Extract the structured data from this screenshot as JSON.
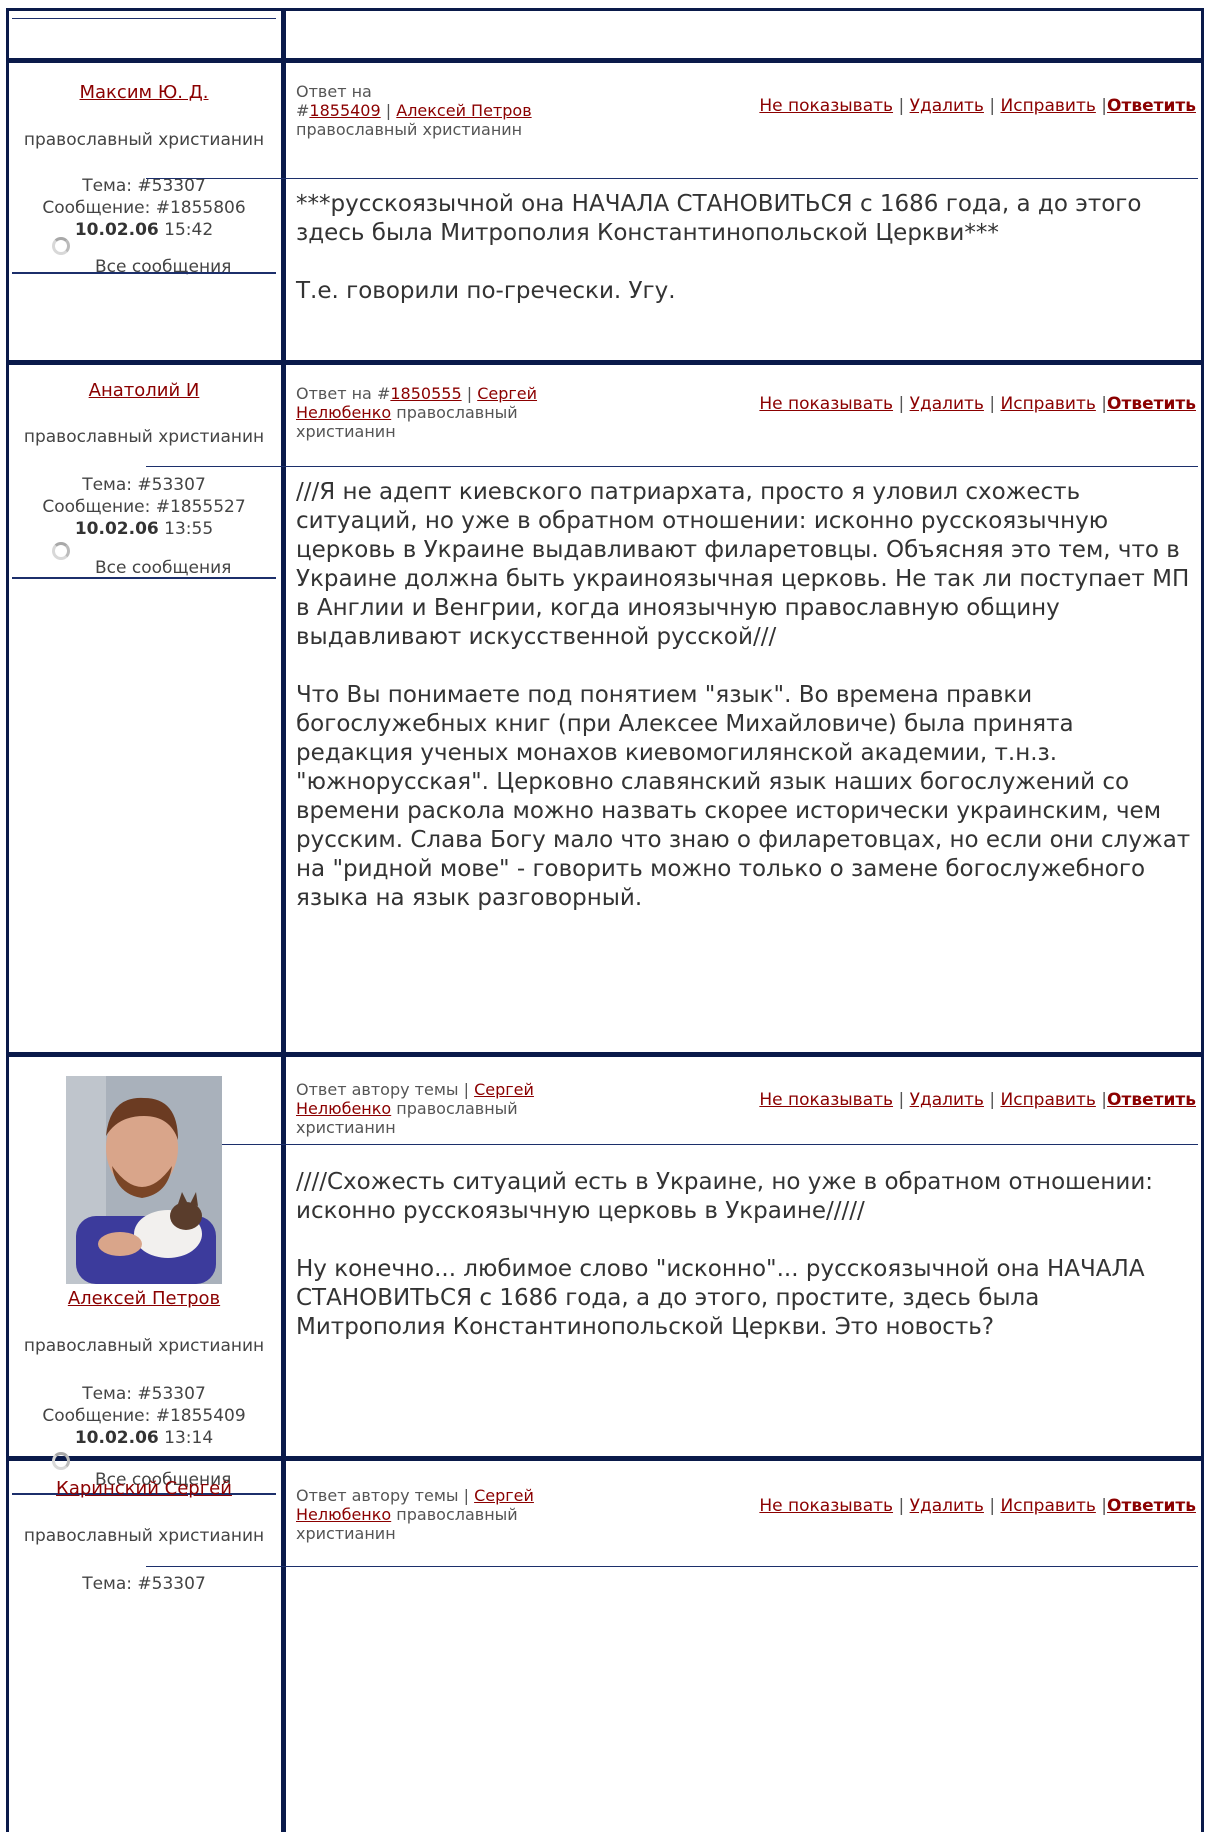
{
  "posts": [
    {
      "author": "Максим Ю. Д.",
      "role": "православный христианин",
      "topic": "Тема: #53307",
      "message": "Сообщение: #1855806",
      "date": "10.02.06",
      "time": "15:42",
      "all_messages": "Все сообщения",
      "reply_prefix": "Ответ на",
      "reply_hash": "#",
      "reply_id": "1855409",
      "reply_sep": "|",
      "reply_author": "Алексей Петров",
      "reply_role": "православный христианин",
      "paragraphs": [
        "***русскоязычной она НАЧАЛА СТАНОВИТЬСЯ с 1686 года, а до этого здесь была Митрополия Константинопольской Церкви***",
        "Т.е. говорили по-гречески. Угу."
      ]
    },
    {
      "author": "Анатолий И",
      "role": "православный христианин",
      "topic": "Тема: #53307",
      "message": "Сообщение: #1855527",
      "date": "10.02.06",
      "time": "13:55",
      "all_messages": "Все сообщения",
      "reply_prefix": "Ответ на #",
      "reply_id": "1850555",
      "reply_sep": "|",
      "reply_author": "Сергей Нелюбенко",
      "reply_role": "православный христианин",
      "paragraphs": [
        "///Я не адепт киевского патриархата, просто я уловил схожесть ситуаций, но уже в обратном отношении: исконно русскоязычную церковь в Украине выдавливают филаретовцы. Объясняя это тем, что в Украине должна быть украиноязычная церковь. Не так ли поступает МП в Англии и Венгрии, когда иноязычную православную общину выдавливают искусственной русской///",
        "Что Вы понимаете под понятием \"язык\". Во времена правки богослужебных книг (при Алексее Михайловиче) была принята редакция ученых монахов киевомогилянской академии, т.н.з. \"южнорусская\". Церковно славянский язык наших богослужений со времени раскола можно назвать скорее исторически украинским, чем русским. Слава Богу мало что знаю о филаретовцах, но если они служат на \"ридной мове\" - говорить можно только о замене богослужебного языка на язык разговорный."
      ]
    },
    {
      "author": "Алексей Петров",
      "role": "православный христианин",
      "topic": "Тема: #53307",
      "message": "Сообщение: #1855409",
      "date": "10.02.06",
      "time": "13:14",
      "all_messages": "Все сообщения",
      "reply_prefix": "Ответ автору темы |",
      "reply_author": "Сергей Нелюбенко",
      "reply_role": "православный христианин",
      "paragraphs": [
        "////Схожесть ситуаций есть в Украине, но уже в обратном отношении: исконно русскоязычную церковь в Украине/////",
        "Ну конечно... любимое слово \"исконно\"... русскоязычной она НАЧАЛА СТАНОВИТЬСЯ с 1686 года, а до этого, простите, здесь была Митрополия Константинопольской Церкви. Это новость?"
      ]
    },
    {
      "author": "Каринский Сергей",
      "role": "православный христианин",
      "topic": "Тема: #53307",
      "reply_prefix": "Ответ автору темы |",
      "reply_author": "Сергей Нелюбенко",
      "reply_role": "православный христианин"
    }
  ],
  "actions": {
    "hide": "Не показывать",
    "delete": "Удалить",
    "edit": "Исправить",
    "reply": "Ответить",
    "sep": "|"
  },
  "colors": {
    "link": "#8b0000",
    "frame": "#0a1a4a",
    "text": "#333333"
  }
}
